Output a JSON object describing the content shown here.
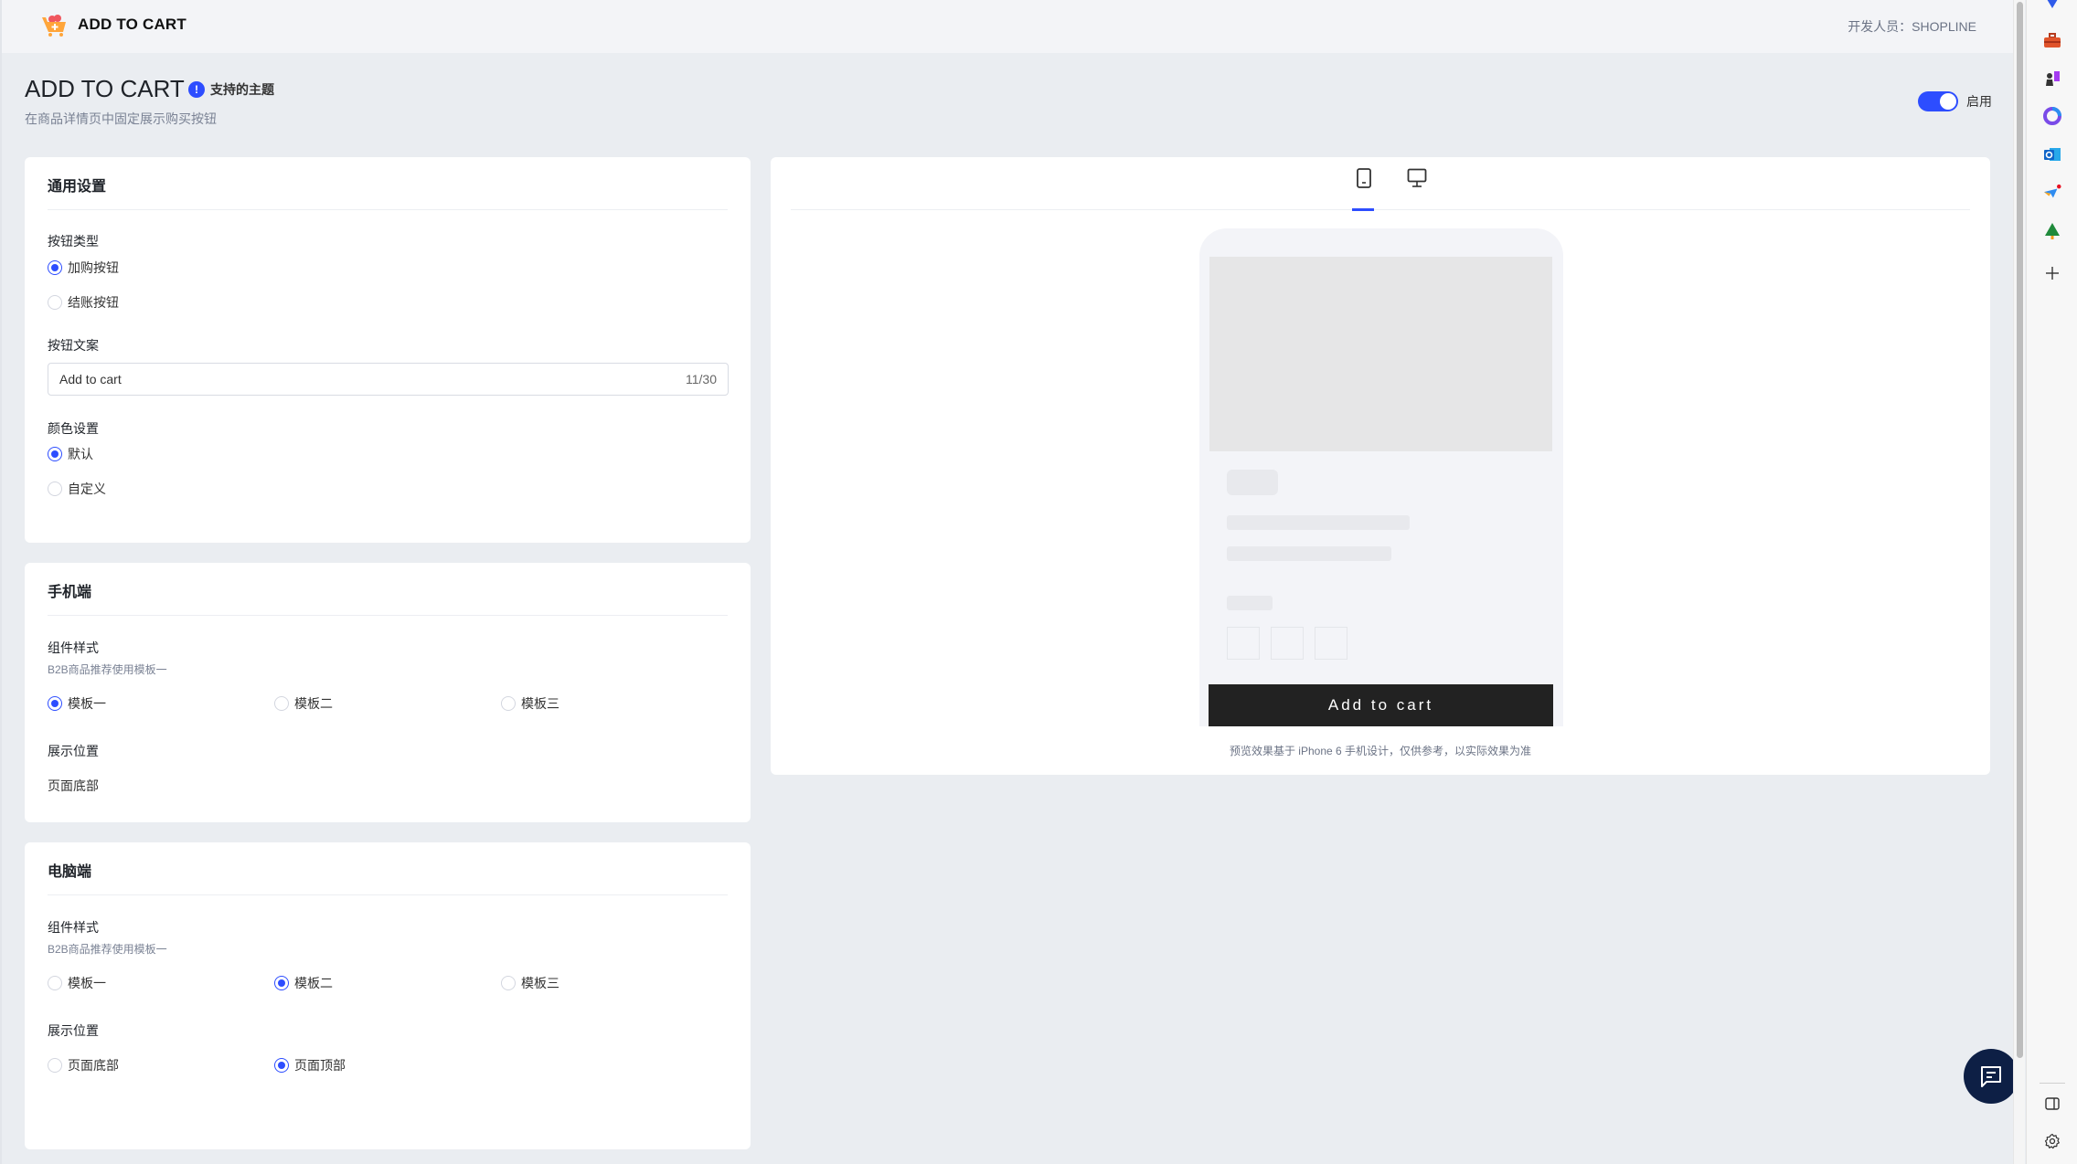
{
  "header": {
    "app_name": "ADD TO CART",
    "developer": "开发人员：SHOPLINE"
  },
  "page": {
    "title": "ADD TO CART",
    "theme_link": "支持的主题",
    "subtitle": "在商品详情页中固定展示购买按钮",
    "enable_label": "启用",
    "enabled": true
  },
  "general": {
    "title": "通用设置",
    "button_type_label": "按钮类型",
    "button_type_options": [
      "加购按钮",
      "结账按钮"
    ],
    "button_type_selected": "加购按钮",
    "button_text_label": "按钮文案",
    "button_text_value": "Add to cart",
    "button_text_count": "11/30",
    "color_label": "颜色设置",
    "color_options": [
      "默认",
      "自定义"
    ],
    "color_selected": "默认"
  },
  "mobile": {
    "title": "手机端",
    "style_label": "组件样式",
    "style_hint": "B2B商品推荐使用模板一",
    "style_options": [
      "模板一",
      "模板二",
      "模板三"
    ],
    "style_selected": "模板一",
    "position_label": "展示位置",
    "position_value": "页面底部"
  },
  "desktop": {
    "title": "电脑端",
    "style_label": "组件样式",
    "style_hint": "B2B商品推荐使用模板一",
    "style_options": [
      "模板一",
      "模板二",
      "模板三"
    ],
    "style_selected": "模板二",
    "position_label": "展示位置",
    "position_options": [
      "页面底部",
      "页面顶部"
    ],
    "position_selected": "页面顶部"
  },
  "preview": {
    "tabs": [
      {
        "icon": "mobile-icon",
        "active": true
      },
      {
        "icon": "desktop-icon",
        "active": false
      }
    ],
    "button_text": "Add to cart",
    "note": "预览效果基于 iPhone 6 手机设计，仅供参考，以实际效果为准"
  },
  "colors": {
    "accent": "#2d4dff",
    "chat_fab": "#0d1f45",
    "preview_button": "#222222"
  },
  "sidebar": {
    "icons": [
      "copilot-icon",
      "toolbox-icon",
      "chess-icon",
      "m365-icon",
      "outlook-icon",
      "send-icon",
      "tree-icon",
      "add-icon"
    ],
    "bottom_icons": [
      "split-view-icon",
      "settings-icon"
    ]
  }
}
